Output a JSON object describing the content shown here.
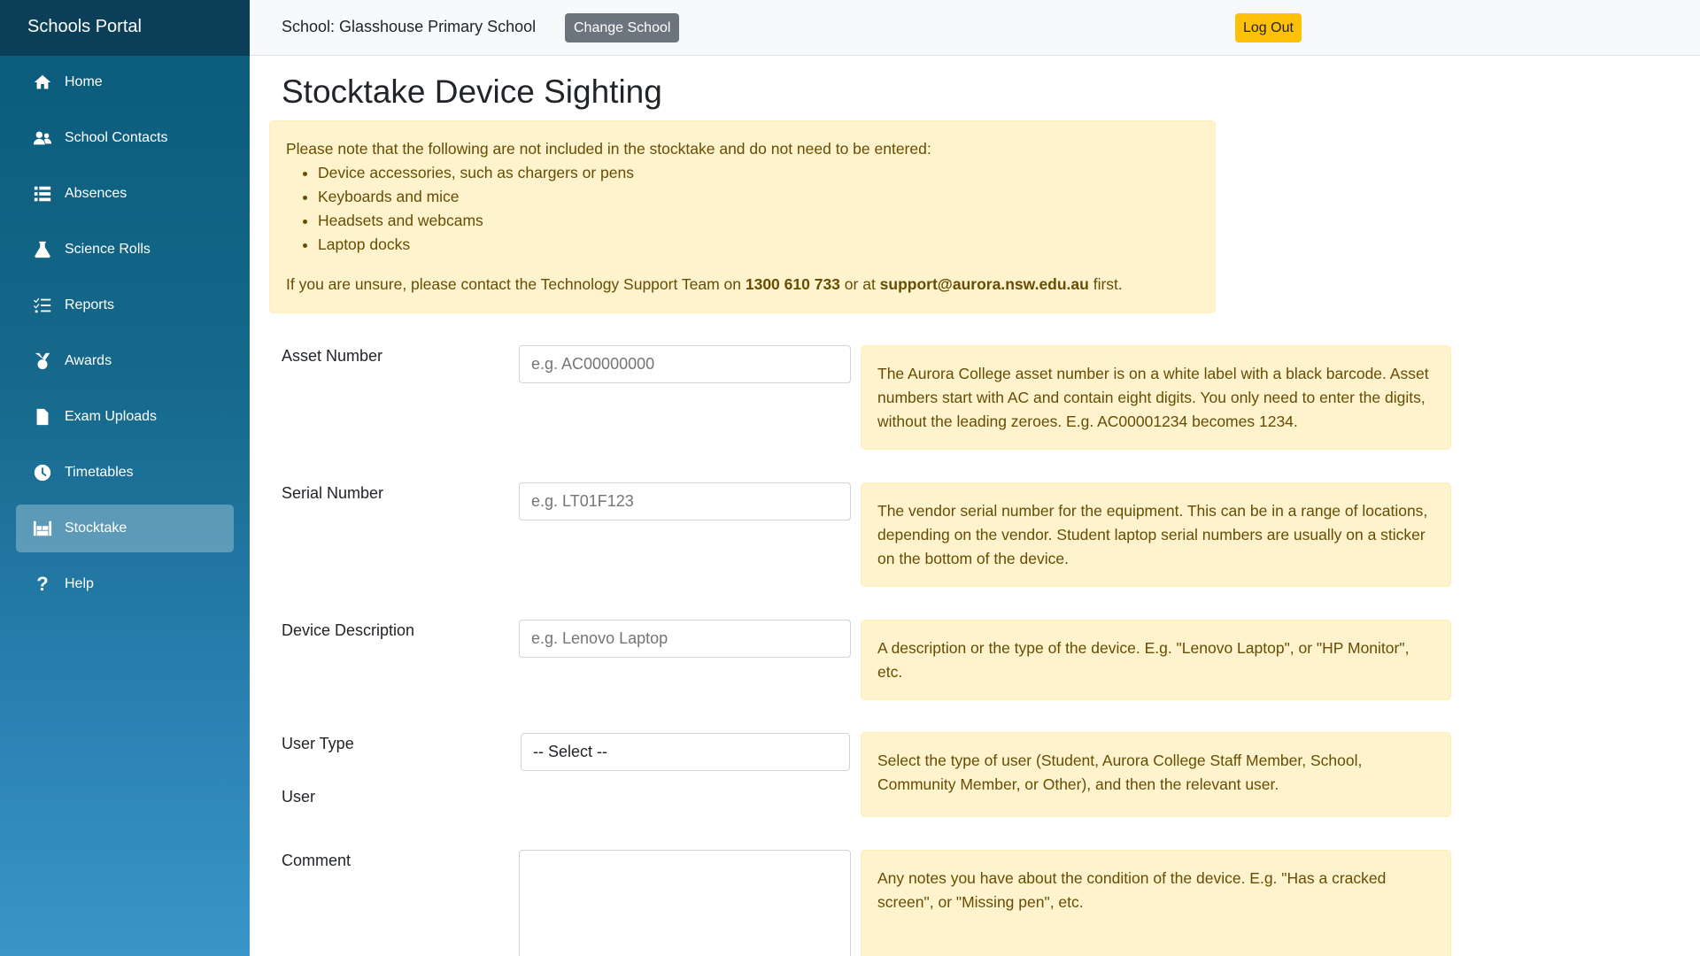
{
  "sidebar": {
    "brand": "Schools Portal",
    "items": [
      {
        "label": "Home",
        "icon": "home-icon"
      },
      {
        "label": "School Contacts",
        "icon": "users-icon"
      },
      {
        "label": "Absences",
        "icon": "list-icon"
      },
      {
        "label": "Science Rolls",
        "icon": "flask-icon"
      },
      {
        "label": "Reports",
        "icon": "checklist-icon"
      },
      {
        "label": "Awards",
        "icon": "medal-icon"
      },
      {
        "label": "Exam Uploads",
        "icon": "file-icon"
      },
      {
        "label": "Timetables",
        "icon": "clock-icon"
      },
      {
        "label": "Stocktake",
        "icon": "warehouse-icon",
        "active": true
      },
      {
        "label": "Help",
        "icon": "question-icon"
      }
    ]
  },
  "topbar": {
    "school_label": "School: Glasshouse Primary School",
    "change_school": "Change School",
    "logout": "Log Out"
  },
  "page": {
    "title": "Stocktake Device Sighting",
    "notice": {
      "intro": "Please note that the following are not included in the stocktake and do not need to be entered:",
      "items": [
        "Device accessories, such as chargers or pens",
        "Keyboards and mice",
        "Headsets and webcams",
        "Laptop docks"
      ],
      "contact_prefix": "If you are unsure, please contact the Technology Support Team on ",
      "phone": "1300 610 733",
      "contact_mid": " or at ",
      "email": "support@aurora.nsw.edu.au",
      "contact_suffix": " first."
    }
  },
  "form": {
    "asset": {
      "label": "Asset Number",
      "placeholder": "e.g. AC00000000",
      "help": "The Aurora College asset number is on a white label with a black barcode. Asset numbers start with AC and contain eight digits. You only need to enter the digits, without the leading zeroes. E.g. AC00001234 becomes 1234."
    },
    "serial": {
      "label": "Serial Number",
      "placeholder": "e.g. LT01F123",
      "help": "The vendor serial number for the equipment. This can be in a range of locations, depending on the vendor. Student laptop serial numbers are usually on a sticker on the bottom of the device."
    },
    "description": {
      "label": "Device Description",
      "placeholder": "e.g. Lenovo Laptop",
      "help": "A description or the type of the device. E.g. \"Lenovo Laptop\", or \"HP Monitor\", etc."
    },
    "user_type": {
      "label": "User Type",
      "selected": "-- Select --",
      "help": "Select the type of user (Student, Aurora College Staff Member, School, Community Member, or Other), and then the relevant user."
    },
    "user": {
      "label": "User"
    },
    "comment": {
      "label": "Comment",
      "help": "Any notes you have about the condition of the device. E.g. \"Has a cracked screen\", or \"Missing pen\", etc."
    }
  }
}
